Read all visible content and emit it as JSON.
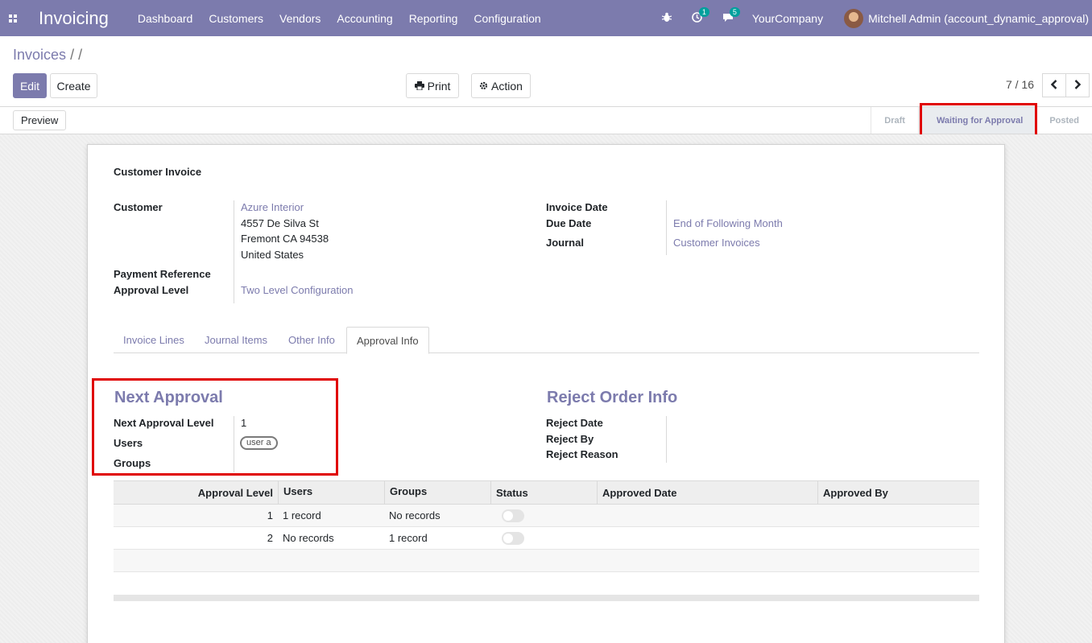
{
  "navbar": {
    "app_title": "Invoicing",
    "menu": [
      "Dashboard",
      "Customers",
      "Vendors",
      "Accounting",
      "Reporting",
      "Configuration"
    ],
    "activity_count": "1",
    "messages_count": "5",
    "company": "YourCompany",
    "user": "Mitchell Admin (account_dynamic_approval)"
  },
  "control": {
    "breadcrumb_root": "Invoices",
    "breadcrumb_sep": "/ /",
    "edit_label": "Edit",
    "create_label": "Create",
    "print_label": "Print",
    "action_label": "Action",
    "pager": "7 / 16"
  },
  "statusbar": {
    "preview_label": "Preview",
    "stages": [
      "Draft",
      "Waiting for Approval",
      "Posted"
    ],
    "active_stage": "Waiting for Approval"
  },
  "invoice": {
    "type_title": "Customer Invoice",
    "customer_label": "Customer",
    "customer_name": "Azure Interior",
    "address_line1": "4557 De Silva St",
    "address_line2": "Fremont CA 94538",
    "address_line3": "United States",
    "payment_ref_label": "Payment Reference",
    "approval_level_label": "Approval Level",
    "approval_level_value": "Two Level Configuration",
    "invoice_date_label": "Invoice Date",
    "due_date_label": "Due Date",
    "due_date_value": "End of Following Month",
    "journal_label": "Journal",
    "journal_value": "Customer Invoices"
  },
  "tabs": [
    "Invoice Lines",
    "Journal Items",
    "Other Info",
    "Approval Info"
  ],
  "next_approval": {
    "title": "Next Approval",
    "level_label": "Next Approval Level",
    "level_value": "1",
    "users_label": "Users",
    "user_tag": "user a",
    "groups_label": "Groups"
  },
  "reject_info": {
    "title": "Reject Order Info",
    "date_label": "Reject Date",
    "by_label": "Reject By",
    "reason_label": "Reject Reason"
  },
  "approval_table": {
    "headers": [
      "Approval Level",
      "Users",
      "Groups",
      "Status",
      "Approved Date",
      "Approved By"
    ],
    "rows": [
      {
        "level": "1",
        "users": "1 record",
        "groups": "No records"
      },
      {
        "level": "2",
        "users": "No records",
        "groups": "1 record"
      }
    ]
  }
}
